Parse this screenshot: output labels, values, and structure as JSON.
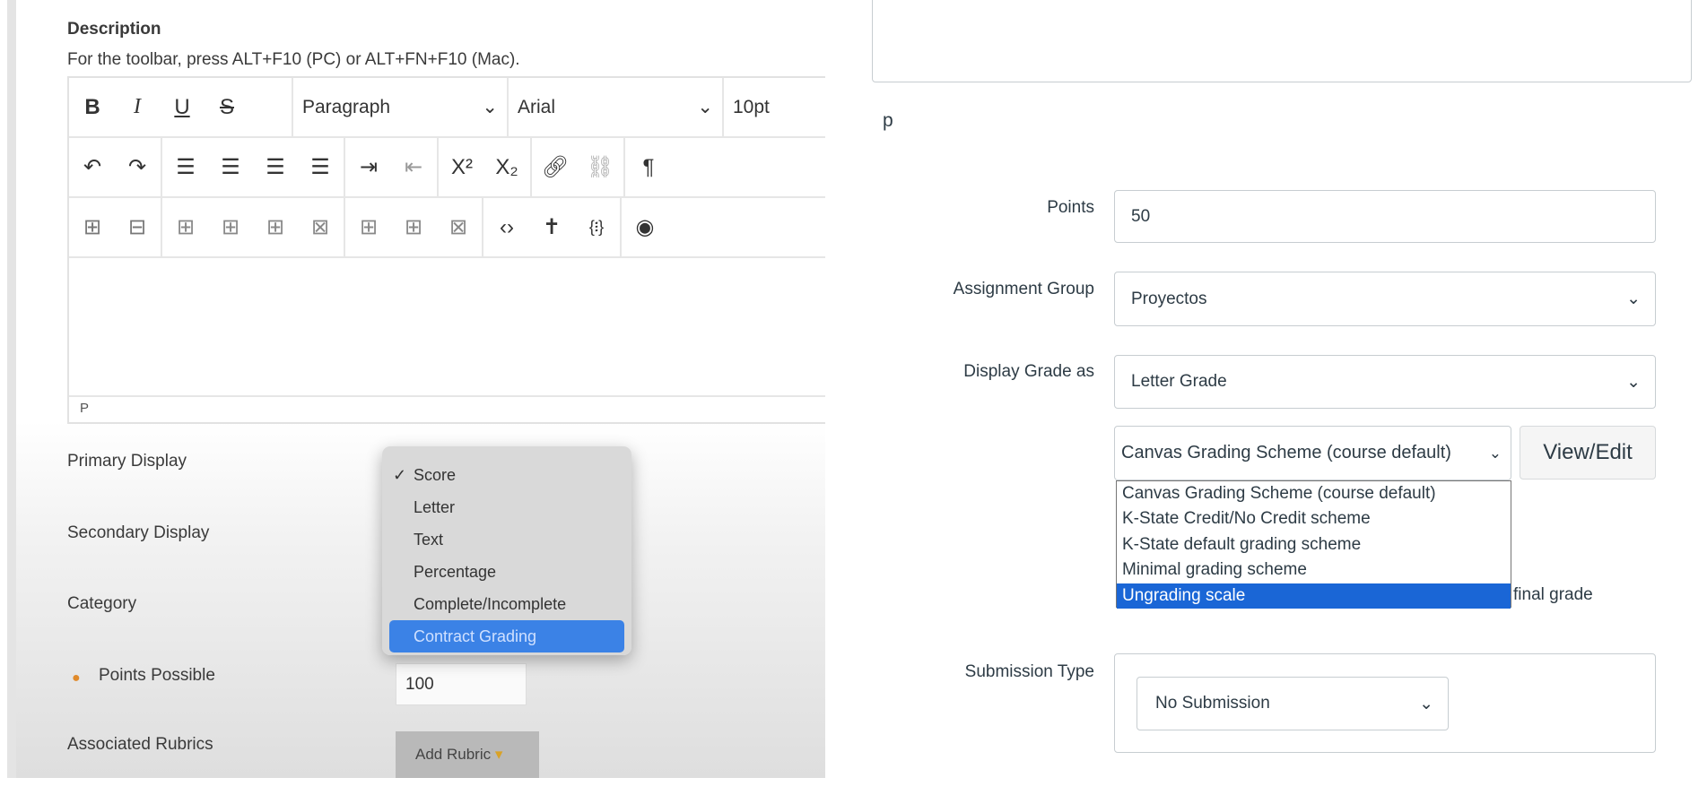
{
  "left": {
    "description_label": "Description",
    "toolbar_hint": "For the toolbar, press ALT+F10 (PC) or ALT+FN+F10 (Mac).",
    "toolbar": {
      "bold": "B",
      "italic": "I",
      "underline": "U",
      "strike": "S",
      "block_format": "Paragraph",
      "font_family": "Arial",
      "font_size": "10pt",
      "superscript": "X²",
      "subscript": "X₂"
    },
    "status_path": "P",
    "primary_display_label": "Primary Display",
    "secondary_display_label": "Secondary Display",
    "category_label": "Category",
    "points_possible_label": "Points Possible",
    "points_possible_value": "100",
    "associated_rubrics_label": "Associated Rubrics",
    "add_rubric_label": "Add Rubric",
    "display_menu": {
      "items": [
        "Score",
        "Letter",
        "Text",
        "Percentage",
        "Complete/Incomplete",
        "Contract Grading"
      ],
      "checked": "Score",
      "highlighted": "Contract Grading"
    }
  },
  "right": {
    "editor_path": "p",
    "points_label": "Points",
    "points_value": "50",
    "assignment_group_label": "Assignment Group",
    "assignment_group_value": "Proyectos",
    "display_grade_label": "Display Grade as",
    "display_grade_value": "Letter Grade",
    "grading_scheme_value": "Canvas Grading Scheme (course default)",
    "view_edit_label": "View/Edit",
    "grading_scheme_options": [
      "Canvas Grading Scheme (course default)",
      "K-State Credit/No Credit scheme",
      "K-State default grading scheme",
      "Minimal grading scheme",
      "Ungrading scale"
    ],
    "grading_scheme_highlighted": "Ungrading scale",
    "final_grade_text": "final grade",
    "submission_type_label": "Submission Type",
    "submission_type_value": "No Submission",
    "highlight_color": "#1a66d6"
  }
}
